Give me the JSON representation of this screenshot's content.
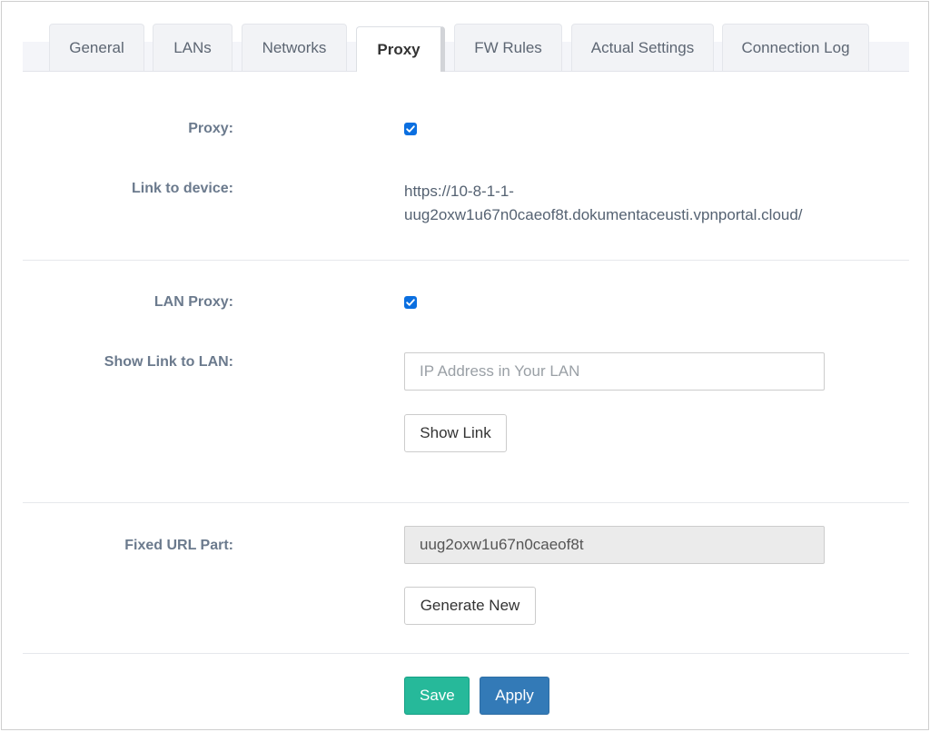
{
  "tabs": [
    {
      "label": "General"
    },
    {
      "label": "LANs"
    },
    {
      "label": "Networks"
    },
    {
      "label": "Proxy",
      "active": true
    },
    {
      "label": "FW Rules"
    },
    {
      "label": "Actual Settings"
    },
    {
      "label": "Connection Log"
    }
  ],
  "proxy": {
    "label": "Proxy:",
    "checked": true,
    "link_label": "Link to device:",
    "link_value": "https://10-8-1-1-uug2oxw1u67n0caeof8t.dokumentaceusti.vpnportal.cloud/",
    "link_line1": "https://10-8-1-1-",
    "link_line2": "uug2oxw1u67n0caeof8t.dokumentaceusti.vpnportal.cloud/"
  },
  "lan_proxy": {
    "label": "LAN Proxy:",
    "checked": true,
    "show_link_label": "Show Link to LAN:",
    "input_placeholder": "IP Address in Your LAN",
    "input_value": "",
    "show_link_button": "Show Link"
  },
  "fixed_url": {
    "label": "Fixed URL Part:",
    "value": "uug2oxw1u67n0caeof8t",
    "generate_button": "Generate New"
  },
  "actions": {
    "save": "Save",
    "apply": "Apply"
  },
  "colors": {
    "checkbox": "#0b6fe0",
    "save": "#26b99a",
    "apply": "#337ab7"
  },
  "icons": {
    "checkbox": "checkmark-icon"
  }
}
